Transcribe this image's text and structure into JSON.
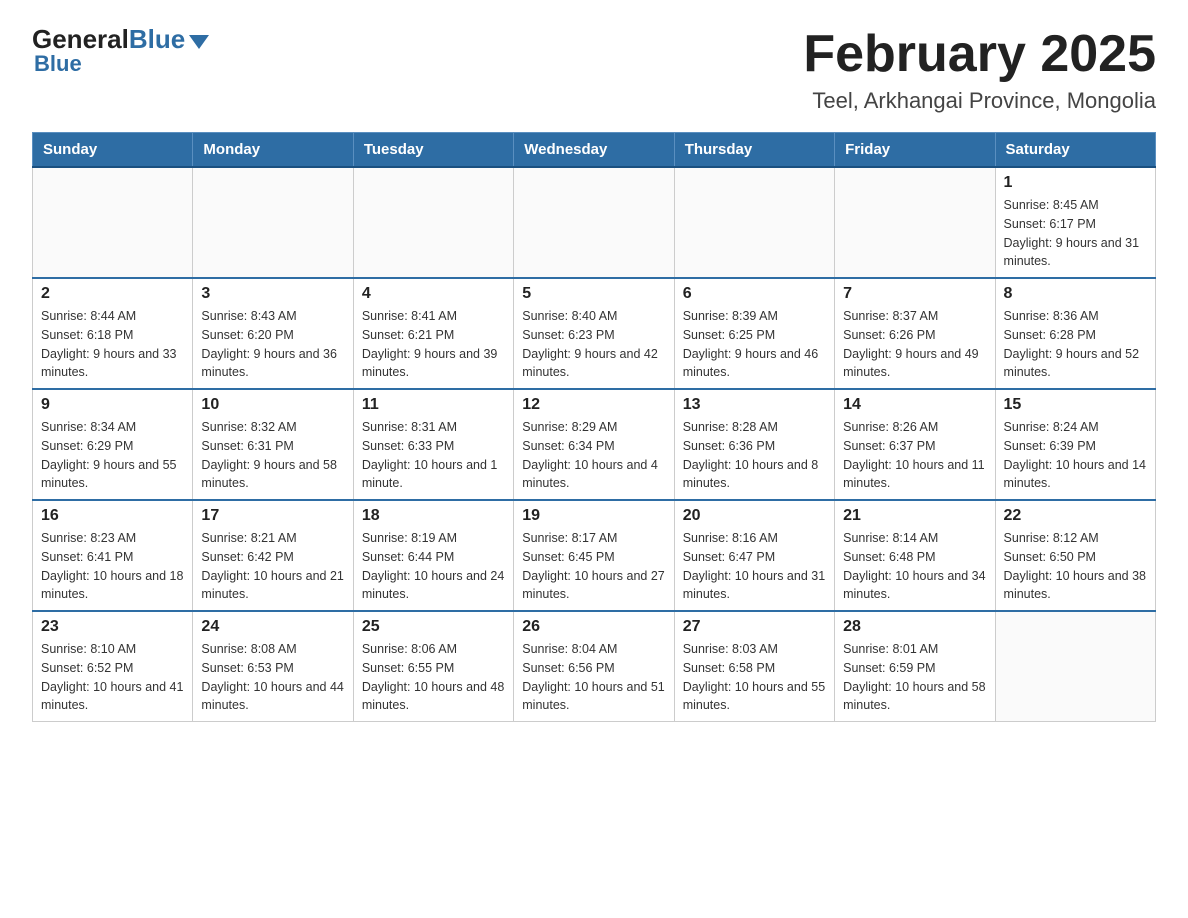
{
  "header": {
    "logo_general": "General",
    "logo_blue": "Blue",
    "title": "February 2025",
    "subtitle": "Teel, Arkhangai Province, Mongolia"
  },
  "weekdays": [
    "Sunday",
    "Monday",
    "Tuesday",
    "Wednesday",
    "Thursday",
    "Friday",
    "Saturday"
  ],
  "weeks": [
    [
      {
        "day": "",
        "sunrise": "",
        "sunset": "",
        "daylight": ""
      },
      {
        "day": "",
        "sunrise": "",
        "sunset": "",
        "daylight": ""
      },
      {
        "day": "",
        "sunrise": "",
        "sunset": "",
        "daylight": ""
      },
      {
        "day": "",
        "sunrise": "",
        "sunset": "",
        "daylight": ""
      },
      {
        "day": "",
        "sunrise": "",
        "sunset": "",
        "daylight": ""
      },
      {
        "day": "",
        "sunrise": "",
        "sunset": "",
        "daylight": ""
      },
      {
        "day": "1",
        "sunrise": "Sunrise: 8:45 AM",
        "sunset": "Sunset: 6:17 PM",
        "daylight": "Daylight: 9 hours and 31 minutes."
      }
    ],
    [
      {
        "day": "2",
        "sunrise": "Sunrise: 8:44 AM",
        "sunset": "Sunset: 6:18 PM",
        "daylight": "Daylight: 9 hours and 33 minutes."
      },
      {
        "day": "3",
        "sunrise": "Sunrise: 8:43 AM",
        "sunset": "Sunset: 6:20 PM",
        "daylight": "Daylight: 9 hours and 36 minutes."
      },
      {
        "day": "4",
        "sunrise": "Sunrise: 8:41 AM",
        "sunset": "Sunset: 6:21 PM",
        "daylight": "Daylight: 9 hours and 39 minutes."
      },
      {
        "day": "5",
        "sunrise": "Sunrise: 8:40 AM",
        "sunset": "Sunset: 6:23 PM",
        "daylight": "Daylight: 9 hours and 42 minutes."
      },
      {
        "day": "6",
        "sunrise": "Sunrise: 8:39 AM",
        "sunset": "Sunset: 6:25 PM",
        "daylight": "Daylight: 9 hours and 46 minutes."
      },
      {
        "day": "7",
        "sunrise": "Sunrise: 8:37 AM",
        "sunset": "Sunset: 6:26 PM",
        "daylight": "Daylight: 9 hours and 49 minutes."
      },
      {
        "day": "8",
        "sunrise": "Sunrise: 8:36 AM",
        "sunset": "Sunset: 6:28 PM",
        "daylight": "Daylight: 9 hours and 52 minutes."
      }
    ],
    [
      {
        "day": "9",
        "sunrise": "Sunrise: 8:34 AM",
        "sunset": "Sunset: 6:29 PM",
        "daylight": "Daylight: 9 hours and 55 minutes."
      },
      {
        "day": "10",
        "sunrise": "Sunrise: 8:32 AM",
        "sunset": "Sunset: 6:31 PM",
        "daylight": "Daylight: 9 hours and 58 minutes."
      },
      {
        "day": "11",
        "sunrise": "Sunrise: 8:31 AM",
        "sunset": "Sunset: 6:33 PM",
        "daylight": "Daylight: 10 hours and 1 minute."
      },
      {
        "day": "12",
        "sunrise": "Sunrise: 8:29 AM",
        "sunset": "Sunset: 6:34 PM",
        "daylight": "Daylight: 10 hours and 4 minutes."
      },
      {
        "day": "13",
        "sunrise": "Sunrise: 8:28 AM",
        "sunset": "Sunset: 6:36 PM",
        "daylight": "Daylight: 10 hours and 8 minutes."
      },
      {
        "day": "14",
        "sunrise": "Sunrise: 8:26 AM",
        "sunset": "Sunset: 6:37 PM",
        "daylight": "Daylight: 10 hours and 11 minutes."
      },
      {
        "day": "15",
        "sunrise": "Sunrise: 8:24 AM",
        "sunset": "Sunset: 6:39 PM",
        "daylight": "Daylight: 10 hours and 14 minutes."
      }
    ],
    [
      {
        "day": "16",
        "sunrise": "Sunrise: 8:23 AM",
        "sunset": "Sunset: 6:41 PM",
        "daylight": "Daylight: 10 hours and 18 minutes."
      },
      {
        "day": "17",
        "sunrise": "Sunrise: 8:21 AM",
        "sunset": "Sunset: 6:42 PM",
        "daylight": "Daylight: 10 hours and 21 minutes."
      },
      {
        "day": "18",
        "sunrise": "Sunrise: 8:19 AM",
        "sunset": "Sunset: 6:44 PM",
        "daylight": "Daylight: 10 hours and 24 minutes."
      },
      {
        "day": "19",
        "sunrise": "Sunrise: 8:17 AM",
        "sunset": "Sunset: 6:45 PM",
        "daylight": "Daylight: 10 hours and 27 minutes."
      },
      {
        "day": "20",
        "sunrise": "Sunrise: 8:16 AM",
        "sunset": "Sunset: 6:47 PM",
        "daylight": "Daylight: 10 hours and 31 minutes."
      },
      {
        "day": "21",
        "sunrise": "Sunrise: 8:14 AM",
        "sunset": "Sunset: 6:48 PM",
        "daylight": "Daylight: 10 hours and 34 minutes."
      },
      {
        "day": "22",
        "sunrise": "Sunrise: 8:12 AM",
        "sunset": "Sunset: 6:50 PM",
        "daylight": "Daylight: 10 hours and 38 minutes."
      }
    ],
    [
      {
        "day": "23",
        "sunrise": "Sunrise: 8:10 AM",
        "sunset": "Sunset: 6:52 PM",
        "daylight": "Daylight: 10 hours and 41 minutes."
      },
      {
        "day": "24",
        "sunrise": "Sunrise: 8:08 AM",
        "sunset": "Sunset: 6:53 PM",
        "daylight": "Daylight: 10 hours and 44 minutes."
      },
      {
        "day": "25",
        "sunrise": "Sunrise: 8:06 AM",
        "sunset": "Sunset: 6:55 PM",
        "daylight": "Daylight: 10 hours and 48 minutes."
      },
      {
        "day": "26",
        "sunrise": "Sunrise: 8:04 AM",
        "sunset": "Sunset: 6:56 PM",
        "daylight": "Daylight: 10 hours and 51 minutes."
      },
      {
        "day": "27",
        "sunrise": "Sunrise: 8:03 AM",
        "sunset": "Sunset: 6:58 PM",
        "daylight": "Daylight: 10 hours and 55 minutes."
      },
      {
        "day": "28",
        "sunrise": "Sunrise: 8:01 AM",
        "sunset": "Sunset: 6:59 PM",
        "daylight": "Daylight: 10 hours and 58 minutes."
      },
      {
        "day": "",
        "sunrise": "",
        "sunset": "",
        "daylight": ""
      }
    ]
  ]
}
